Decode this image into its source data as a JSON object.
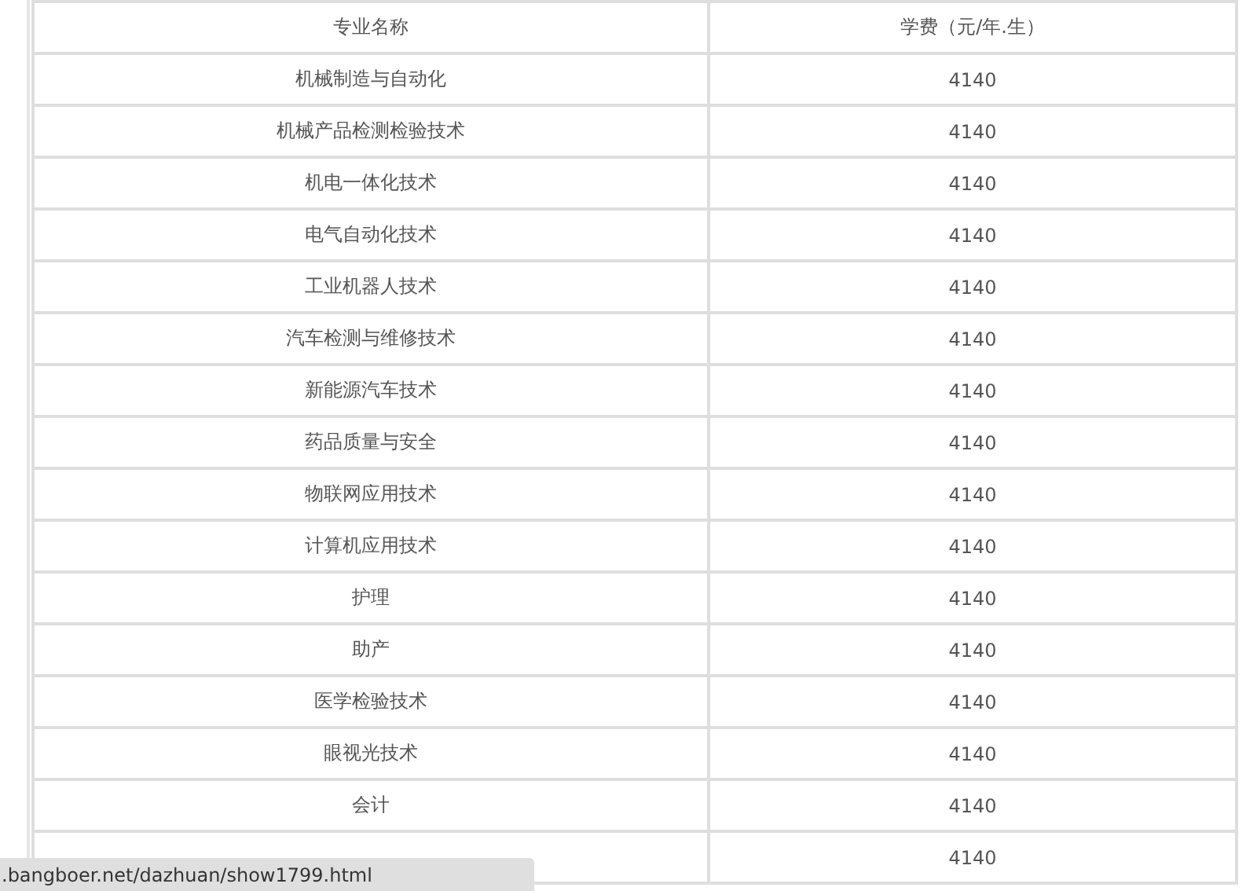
{
  "table": {
    "columns": [
      "专业名称",
      "学费（元/年.生）"
    ],
    "rows": [
      {
        "major": "机械制造与自动化",
        "fee": "4140"
      },
      {
        "major": "机械产品检测检验技术",
        "fee": "4140"
      },
      {
        "major": "机电一体化技术",
        "fee": "4140"
      },
      {
        "major": "电气自动化技术",
        "fee": "4140"
      },
      {
        "major": "工业机器人技术",
        "fee": "4140"
      },
      {
        "major": "汽车检测与维修技术",
        "fee": "4140"
      },
      {
        "major": "新能源汽车技术",
        "fee": "4140"
      },
      {
        "major": "药品质量与安全",
        "fee": "4140"
      },
      {
        "major": "物联网应用技术",
        "fee": "4140"
      },
      {
        "major": "计算机应用技术",
        "fee": "4140"
      },
      {
        "major": "护理",
        "fee": "4140"
      },
      {
        "major": "助产",
        "fee": "4140"
      },
      {
        "major": "医学检验技术",
        "fee": "4140"
      },
      {
        "major": "眼视光技术",
        "fee": "4140"
      },
      {
        "major": "会计",
        "fee": "4140"
      },
      {
        "fee": "4140"
      }
    ]
  },
  "status_bar": {
    "url": ".bangboer.net/dazhuan/show1799.html"
  }
}
